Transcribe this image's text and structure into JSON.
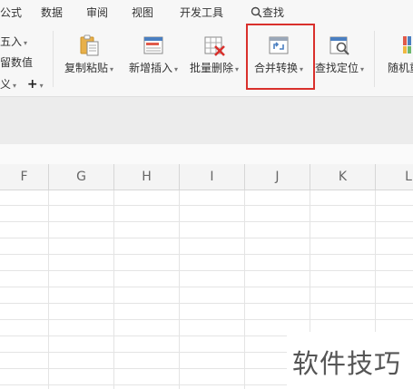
{
  "menu": {
    "formula_partial": "公式",
    "data": "数据",
    "review": "审阅",
    "view": "视图",
    "developer": "开发工具",
    "search": "查找"
  },
  "left_group": {
    "insert_partial": "五入",
    "value_partial": "留数值",
    "custom_partial": "义",
    "plus": "+"
  },
  "tools": [
    {
      "label": "复制粘贴",
      "icon": "clipboard-icon"
    },
    {
      "label": "新增插入",
      "icon": "insert-rows-icon"
    },
    {
      "label": "批量删除",
      "icon": "delete-table-icon"
    },
    {
      "label": "合并转换",
      "icon": "merge-convert-icon"
    },
    {
      "label": "查找定位",
      "icon": "find-locate-icon"
    },
    {
      "label": "随机重",
      "icon": "random-icon"
    }
  ],
  "columns": [
    "F",
    "G",
    "H",
    "I",
    "J",
    "K",
    "L"
  ],
  "watermark": "软件技巧",
  "colors": {
    "highlight": "#d9302c",
    "toolbar_bg": "#f7f7f7"
  }
}
